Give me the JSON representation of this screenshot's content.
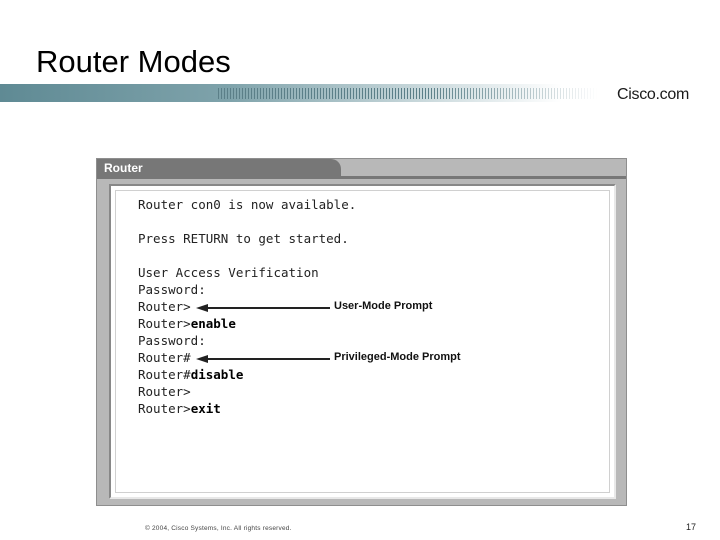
{
  "slide": {
    "title": "Router Modes",
    "brand": "Cisco.com",
    "footer": "© 2004, Cisco Systems, Inc. All rights reserved.",
    "page_number": "17"
  },
  "window": {
    "title": "Router"
  },
  "terminal": {
    "lines": [
      {
        "prompt": "Router con0 is now available.",
        "command": ""
      },
      {
        "prompt": "Press RETURN to get started.",
        "command": ""
      },
      {
        "prompt": "User Access Verification",
        "command": ""
      },
      {
        "prompt": "Password:",
        "command": ""
      },
      {
        "prompt": "Router>",
        "command": ""
      },
      {
        "prompt": "Router>",
        "command": "enable"
      },
      {
        "prompt": "Password:",
        "command": ""
      },
      {
        "prompt": "Router#",
        "command": ""
      },
      {
        "prompt": "Router#",
        "command": "disable"
      },
      {
        "prompt": "Router>",
        "command": ""
      },
      {
        "prompt": "Router>",
        "command": "exit"
      }
    ]
  },
  "callouts": {
    "user_mode": "User-Mode Prompt",
    "privileged_mode": "Privileged-Mode Prompt"
  }
}
